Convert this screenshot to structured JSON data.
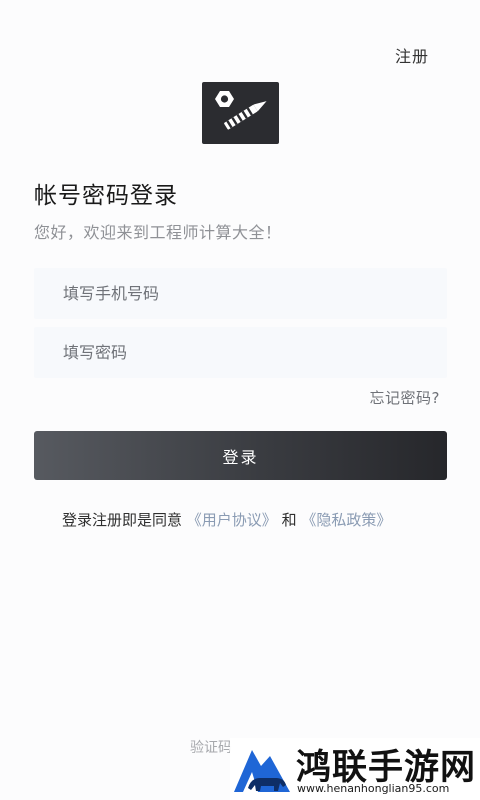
{
  "header": {
    "register_label": "注册"
  },
  "login": {
    "title": "帐号密码登录",
    "subtitle": "您好，欢迎来到工程师计算大全！",
    "phone_placeholder": "填写手机号码",
    "password_placeholder": "填写密码",
    "forgot_label": "忘记密码?",
    "submit_label": "登录"
  },
  "agreement": {
    "prefix": "登录注册即是同意",
    "user_agreement": "《用户协议》",
    "connector": "和",
    "privacy_policy": "《隐私政策》"
  },
  "footer": {
    "partial_label": "验证码"
  },
  "watermark": {
    "site_name": "鸿联手游网",
    "url": "www.henanhonglian95.com"
  },
  "colors": {
    "button_start": "#575a60",
    "button_end": "#26272b",
    "link": "#8a9bb3",
    "watermark_blue": "#1f66d6"
  },
  "icons": {
    "app_logo": "nut-and-screw-icon",
    "watermark_logo": "bull-mountain-icon"
  }
}
